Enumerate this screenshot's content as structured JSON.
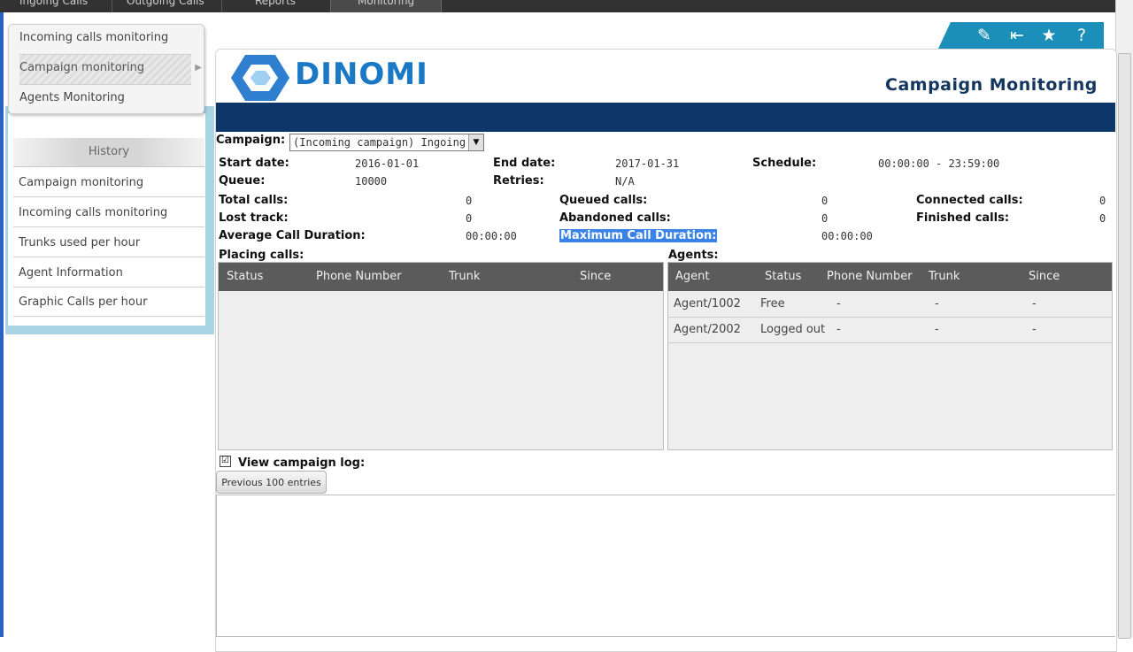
{
  "topnav": {
    "items": [
      "Ingoing Calls",
      "Outgoing Calls",
      "Reports",
      "Monitoring"
    ]
  },
  "submenu": {
    "items": [
      "Incoming calls monitoring",
      "Campaign monitoring",
      "Agents Monitoring"
    ]
  },
  "history": {
    "header": "History",
    "items": [
      "Campaign monitoring",
      "Incoming calls monitoring",
      "Trunks used per hour",
      "Agent Information",
      "Graphic Calls per hour"
    ]
  },
  "toolbar": {
    "icons": [
      "edit-icon",
      "collapse-icon",
      "star-icon",
      "help-icon"
    ],
    "glyphs": [
      "✎",
      "⇤",
      "★",
      "?"
    ]
  },
  "brand": {
    "name": "DINOMI",
    "logo_colors": [
      "#2f7fd0",
      "#9fd0f2"
    ]
  },
  "page": {
    "title": "Campaign Monitoring",
    "banner_color": "#0d3769"
  },
  "campaign": {
    "label": "Campaign:",
    "selected": "(Incoming campaign) Ingoing",
    "start_date_label": "Start date:",
    "start_date": "2016-01-01",
    "end_date_label": "End date:",
    "end_date": "2017-01-31",
    "schedule_label": "Schedule:",
    "schedule": "00:00:00 - 23:59:00",
    "queue_label": "Queue:",
    "queue": "10000",
    "retries_label": "Retries:",
    "retries": "N/A"
  },
  "stats": {
    "total_calls_label": "Total calls:",
    "total_calls": "0",
    "queued_calls_label": "Queued calls:",
    "queued_calls": "0",
    "connected_calls_label": "Connected calls:",
    "connected_calls": "0",
    "lost_track_label": "Lost track:",
    "lost_track": "0",
    "abandoned_calls_label": "Abandoned calls:",
    "abandoned_calls": "0",
    "finished_calls_label": "Finished calls:",
    "finished_calls": "0",
    "avg_duration_label": "Average Call Duration:",
    "avg_duration": "00:00:00",
    "max_duration_label": "Maximum Call Duration:",
    "max_duration": "00:00:00"
  },
  "placing_calls": {
    "title": "Placing calls:",
    "columns": [
      "Status",
      "Phone Number",
      "Trunk",
      "Since"
    ],
    "rows": []
  },
  "agents": {
    "title": "Agents:",
    "columns": [
      "Agent",
      "Status",
      "Phone Number",
      "Trunk",
      "Since"
    ],
    "rows": [
      [
        "Agent/1002",
        "Free",
        "-",
        "-",
        "-"
      ],
      [
        "Agent/2002",
        "Logged out",
        "-",
        "-",
        "-"
      ]
    ]
  },
  "log": {
    "checkbox_label": "View campaign log:",
    "checked": true,
    "check_glyph": "☑",
    "prev_button": "Previous 100 entries"
  }
}
